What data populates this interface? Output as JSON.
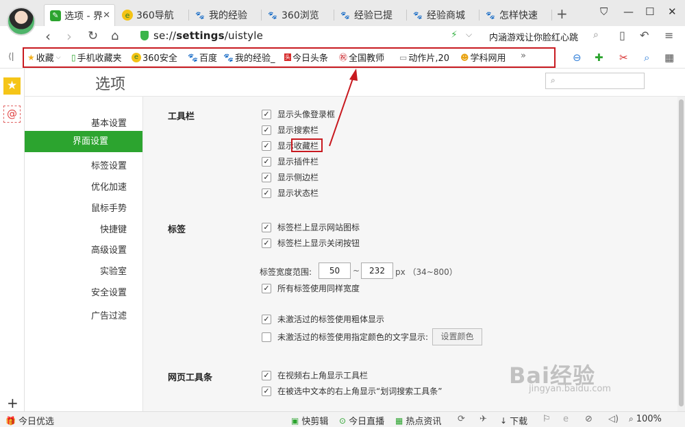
{
  "tabs": [
    {
      "label": "选项 - 界",
      "icon": "wrench-icon",
      "active": true
    },
    {
      "label": "360导航",
      "icon": "360-icon"
    },
    {
      "label": "我的经验",
      "icon": "baidu-paw-icon"
    },
    {
      "label": "360浏览",
      "icon": "baidu-paw-icon"
    },
    {
      "label": "经验已提",
      "icon": "baidu-paw-icon"
    },
    {
      "label": "经验商城",
      "icon": "baidu-paw-icon"
    },
    {
      "label": "怎样快速",
      "icon": "baidu-paw-icon"
    }
  ],
  "address": {
    "url_prefix": "se://",
    "url_bold": "settings",
    "url_suffix": "/uistyle",
    "search_suggestion": "内涵游戏让你脸红心跳"
  },
  "favorites": {
    "items": [
      {
        "label": "收藏",
        "icon": "star-icon"
      },
      {
        "label": "手机收藏夹",
        "icon": "phone-icon"
      },
      {
        "label": "360安全",
        "icon": "360-icon"
      },
      {
        "label": "百度",
        "icon": "baidu-paw-icon"
      },
      {
        "label": "我的经验_",
        "icon": "baidu-paw-icon"
      },
      {
        "label": "今日头条",
        "icon": "toutiao-icon"
      },
      {
        "label": "全国教师",
        "icon": "teacher-icon"
      },
      {
        "label": "动作片,20",
        "icon": "page-icon"
      },
      {
        "label": "学科网用",
        "icon": "xueke-icon"
      }
    ],
    "more": "»"
  },
  "page": {
    "title": "选项",
    "nav": [
      {
        "label": "基本设置"
      },
      {
        "label": "界面设置",
        "active": true
      },
      {
        "label": "标签设置"
      },
      {
        "label": "优化加速"
      },
      {
        "label": "鼠标手势"
      },
      {
        "label": "快捷键"
      },
      {
        "label": "高级设置"
      },
      {
        "label": "实验室"
      },
      {
        "label": "安全设置"
      },
      {
        "label": "广告过滤"
      }
    ]
  },
  "settings": {
    "toolbar": {
      "title": "工具栏",
      "options": [
        {
          "label": "显示头像登录框",
          "checked": true
        },
        {
          "label": "显示搜索栏",
          "checked": true
        },
        {
          "label": "显示收藏栏",
          "checked": true
        },
        {
          "label": "显示插件栏",
          "checked": true
        },
        {
          "label": "显示侧边栏",
          "checked": true
        },
        {
          "label": "显示状态栏",
          "checked": true
        }
      ]
    },
    "tabs": {
      "title": "标签",
      "options": [
        {
          "label": "标签栏上显示网站图标",
          "checked": true
        },
        {
          "label": "标签栏上显示关闭按钮",
          "checked": true
        }
      ],
      "width_label": "标签宽度范围:",
      "width_min": "50",
      "tilde": "~",
      "width_max": "232",
      "unit": "px （34~800）",
      "same_width": {
        "label": "所有标签使用同样宽度",
        "checked": true
      },
      "bold_inactive": {
        "label": "未激活过的标签使用粗体显示",
        "checked": true
      },
      "color_inactive": {
        "label": "未激活过的标签使用指定颜色的文字显示:",
        "checked": false
      },
      "color_button": "设置颜色"
    },
    "webtoolbar": {
      "title": "网页工具条",
      "options": [
        {
          "label": "在视频右上角显示工具栏",
          "checked": true
        },
        {
          "label": "在被选中文本的右上角显示“划词搜索工具条”",
          "checked": true
        }
      ]
    }
  },
  "statusbar": {
    "left": "今日优选",
    "items": [
      {
        "label": "快剪辑",
        "icon": "scissors-icon"
      },
      {
        "label": "今日直播",
        "icon": "play-icon"
      },
      {
        "label": "热点资讯",
        "icon": "grid-icon"
      },
      {
        "label": "下载",
        "icon": "download-icon"
      }
    ],
    "zoom": "100%"
  },
  "watermark": {
    "text": "Bai经验",
    "sub": "jingyan.baidu.com"
  },
  "colors": {
    "accent_green": "#2ca42f",
    "highlight_red": "#c8191f"
  }
}
